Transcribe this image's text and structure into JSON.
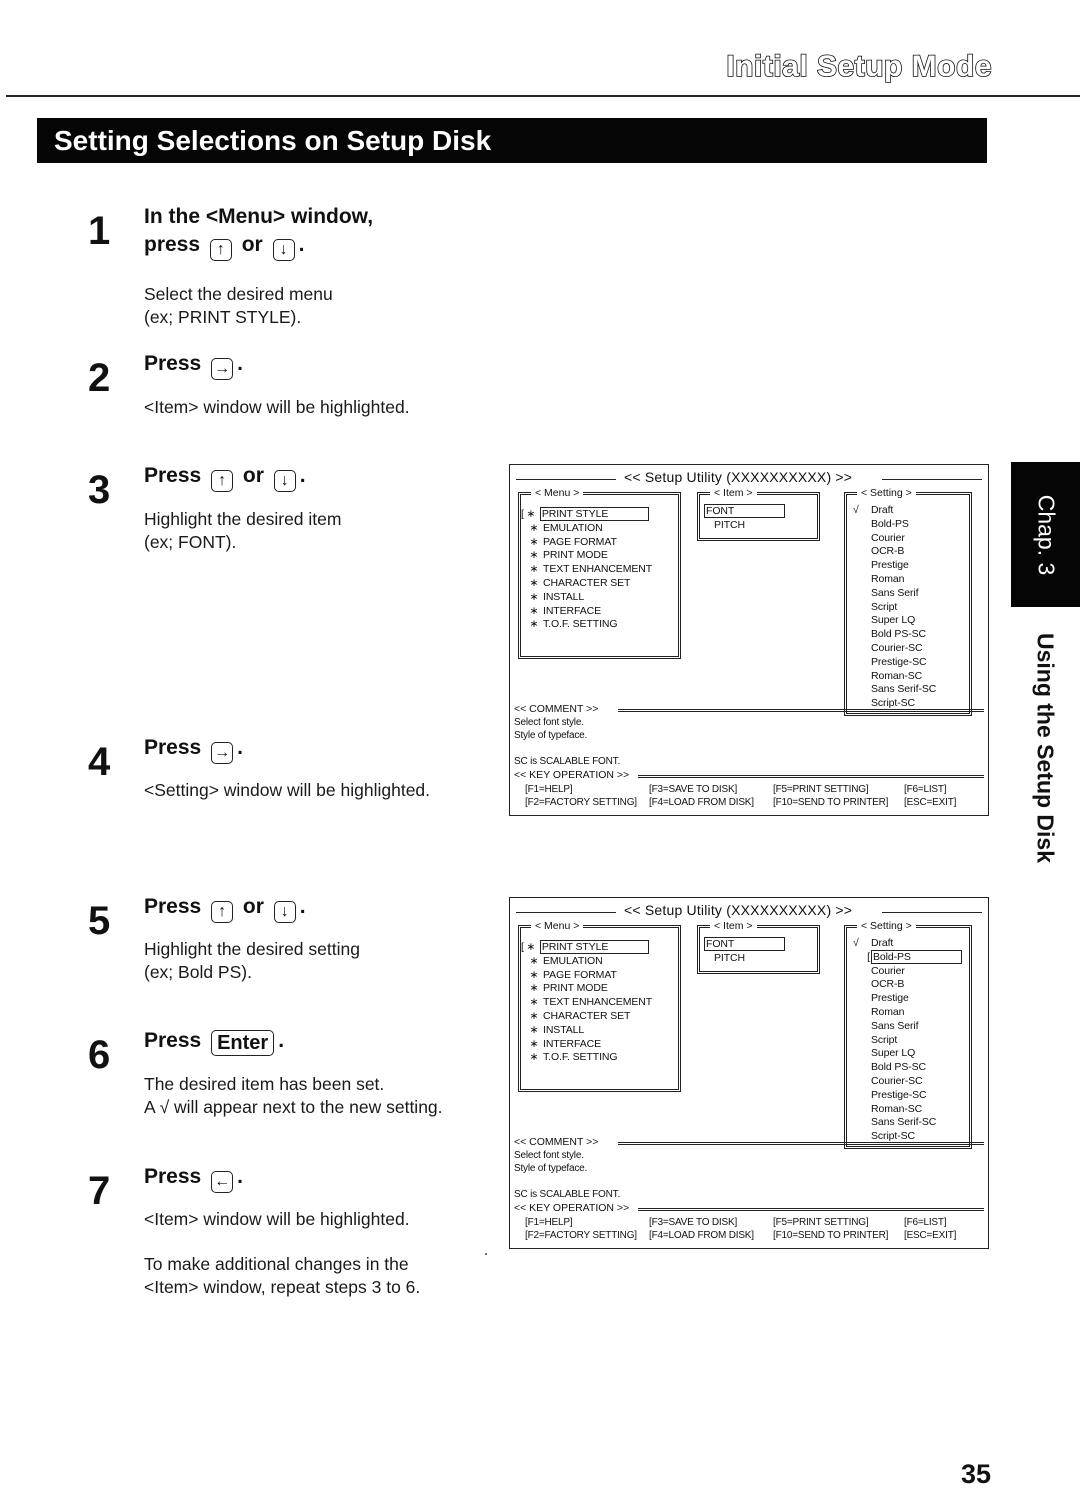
{
  "header": {
    "title": "Initial Setup Mode",
    "section": "Setting Selections on Setup Disk"
  },
  "steps": [
    {
      "number": "1",
      "head_line1": "In the <Menu> window,",
      "head_prefix": "press",
      "keys": [
        "↑",
        "↓"
      ],
      "connector": "or",
      "body": [
        "Select the desired menu",
        "(ex;  PRINT STYLE)."
      ]
    },
    {
      "number": "2",
      "head_prefix": "Press",
      "keys": [
        "→"
      ],
      "body": [
        "<Item> window will be highlighted."
      ]
    },
    {
      "number": "3",
      "head_prefix": "Press",
      "keys": [
        "↑",
        "↓"
      ],
      "connector": "or",
      "body": [
        "Highlight the desired item",
        "(ex;  FONT)."
      ]
    },
    {
      "number": "4",
      "head_prefix": "Press",
      "keys": [
        "→"
      ],
      "body": [
        "<Setting> window will be highlighted."
      ]
    },
    {
      "number": "5",
      "head_prefix": "Press",
      "keys": [
        "↑",
        "↓"
      ],
      "connector": "or",
      "body": [
        "Highlight the desired setting",
        "(ex;  Bold PS)."
      ]
    },
    {
      "number": "6",
      "head_prefix": "Press",
      "keys": [
        "Enter"
      ],
      "body": [
        "The desired item has been set.",
        "A √ will appear next to the new setting."
      ]
    },
    {
      "number": "7",
      "head_prefix": "Press",
      "keys": [
        "←"
      ],
      "body": [
        "<Item> window will be highlighted."
      ],
      "note": [
        "To make additional changes in the",
        "<Item> window, repeat steps 3 to 6."
      ]
    }
  ],
  "screens": [
    {
      "title": "<<  Setup Utility (XXXXXXXXXX)  >>",
      "menu_label": "< Menu >",
      "menu_items": [
        "PRINT STYLE",
        "EMULATION",
        "PAGE FORMAT",
        "PRINT MODE",
        "TEXT ENHANCEMENT",
        "CHARACTER SET",
        "INSTALL",
        "INTERFACE",
        "T.O.F. SETTING"
      ],
      "menu_selected": 0,
      "item_label": "< Item >",
      "item_items": [
        "FONT",
        "PITCH"
      ],
      "item_selected": 0,
      "setting_label": "< Setting >",
      "setting_items": [
        "Draft",
        "Bold-PS",
        "Courier",
        "OCR-B",
        "Prestige",
        "Roman",
        "Sans Serif",
        "Script",
        "Super LQ",
        "Bold PS-SC",
        "Courier-SC",
        "Prestige-SC",
        "Roman-SC",
        "Sans Serif-SC",
        "Script-SC"
      ],
      "setting_checked": 0,
      "setting_highlighted": null,
      "comment_label": "<<  COMMENT  >>",
      "comment_lines": [
        "Select font style.",
        "Style of typeface.",
        "",
        "SC is SCALABLE FONT."
      ],
      "keyop_label": "<<  KEY OPERATION  >>",
      "keys": [
        "[F1=HELP]",
        "[F3=SAVE TO DISK]",
        "[F5=PRINT SETTING]",
        "[F6=LIST]",
        "[F2=FACTORY SETTING]",
        "[F4=LOAD FROM DISK]",
        "[F10=SEND TO PRINTER]",
        "[ESC=EXIT]"
      ]
    },
    {
      "title": "<<  Setup Utility (XXXXXXXXXX)  >>",
      "menu_label": "< Menu >",
      "menu_items": [
        "PRINT STYLE",
        "EMULATION",
        "PAGE FORMAT",
        "PRINT MODE",
        "TEXT ENHANCEMENT",
        "CHARACTER SET",
        "INSTALL",
        "INTERFACE",
        "T.O.F. SETTING"
      ],
      "menu_selected": 0,
      "item_label": "< Item >",
      "item_items": [
        "FONT",
        "PITCH"
      ],
      "item_selected": 0,
      "setting_label": "< Setting >",
      "setting_items": [
        "Draft",
        "Bold-PS",
        "Courier",
        "OCR-B",
        "Prestige",
        "Roman",
        "Sans Serif",
        "Script",
        "Super LQ",
        "Bold PS-SC",
        "Courier-SC",
        "Prestige-SC",
        "Roman-SC",
        "Sans Serif-SC",
        "Script-SC"
      ],
      "setting_checked": 0,
      "setting_highlighted": 1,
      "comment_label": "<<  COMMENT  >>",
      "comment_lines": [
        "Select font style.",
        "Style of typeface.",
        "",
        "SC is SCALABLE FONT."
      ],
      "keyop_label": "<<  KEY OPERATION  >>",
      "keys": [
        "[F1=HELP]",
        "[F3=SAVE TO DISK]",
        "[F5=PRINT SETTING]",
        "[F6=LIST]",
        "[F2=FACTORY SETTING]",
        "[F4=LOAD FROM DISK]",
        "[F10=SEND TO PRINTER]",
        "[ESC=EXIT]"
      ]
    }
  ],
  "symbols": {
    "menu_bullet": "∗",
    "check": "√"
  },
  "side_tab": {
    "chapter": "Chap. 3",
    "chapter_title": "Using the Setup Disk"
  },
  "page_number": "35"
}
